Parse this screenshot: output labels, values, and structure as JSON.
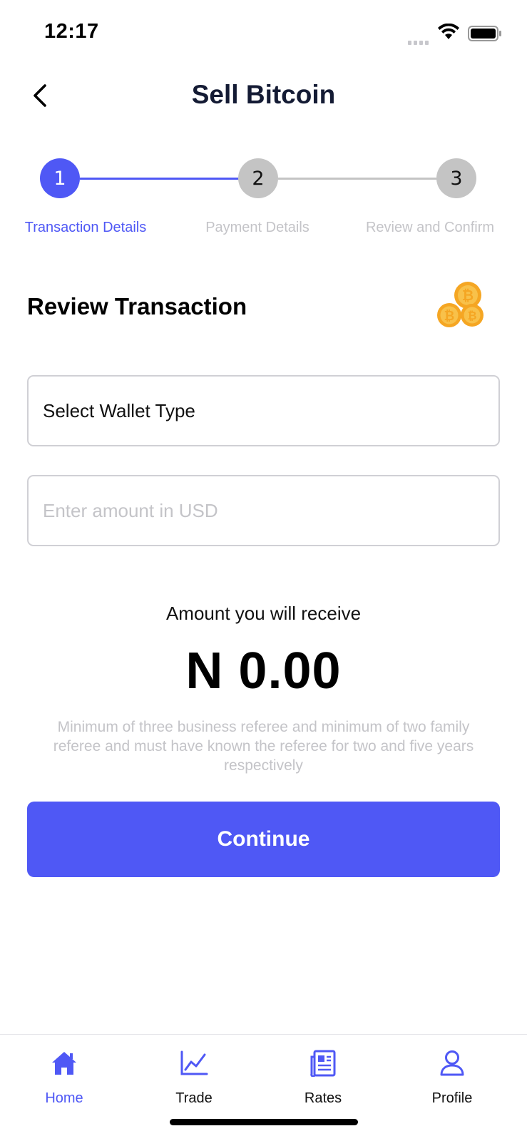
{
  "status_bar": {
    "time": "12:17"
  },
  "header": {
    "title": "Sell Bitcoin",
    "back_icon": "chevron-left-icon"
  },
  "stepper": {
    "steps": [
      {
        "number": "1",
        "label": "Transaction Details",
        "active": true
      },
      {
        "number": "2",
        "label": "Payment Details",
        "active": false
      },
      {
        "number": "3",
        "label": "Review and Confirm",
        "active": false
      }
    ],
    "active_color": "#4f58f5",
    "inactive_color": "#c4c4c4"
  },
  "review": {
    "title": "Review Transaction",
    "icon": "bitcoin-coins-icon"
  },
  "form": {
    "wallet_type_label": "Select Wallet Type",
    "amount_placeholder": "Enter amount in USD",
    "amount_value": ""
  },
  "receive": {
    "label": "Amount you will receive",
    "amount": "N 0.00"
  },
  "note": "Minimum of three business referee and minimum of two family referee and must have known the referee for two and five years respectively",
  "continue_label": "Continue",
  "tab_bar": {
    "tabs": [
      {
        "label": "Home",
        "icon": "home-icon",
        "active": true
      },
      {
        "label": "Trade",
        "icon": "chart-icon",
        "active": false
      },
      {
        "label": "Rates",
        "icon": "rates-news-icon",
        "active": false
      },
      {
        "label": "Profile",
        "icon": "user-icon",
        "active": false
      }
    ]
  },
  "colors": {
    "accent": "#4f58f5",
    "coin": "#f5a623",
    "muted": "#c4c4c8"
  }
}
